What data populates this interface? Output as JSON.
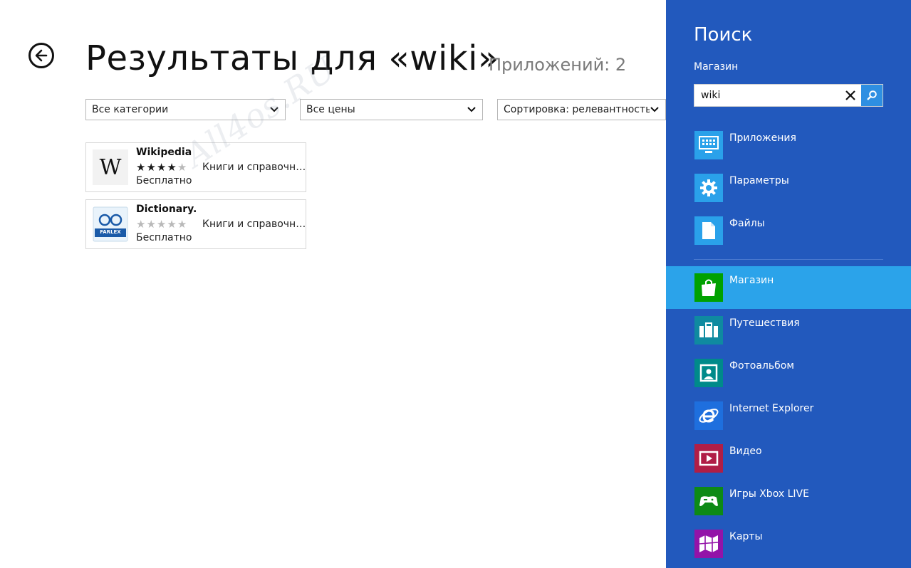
{
  "header": {
    "title": "Результаты для «wiki»",
    "count": "Приложений: 2"
  },
  "filters": [
    {
      "label": "Все категории"
    },
    {
      "label": "Все цены"
    },
    {
      "label": "Сортировка: релевантность"
    }
  ],
  "results": [
    {
      "name": "Wikipedia",
      "rating": 4,
      "max_rating": 5,
      "category": "Книги и справочн…",
      "price": "Бесплатно",
      "icon": "wikipedia-logo-icon",
      "tile_letter": "W"
    },
    {
      "name": "Dictionary.",
      "rating": 0,
      "max_rating": 5,
      "category": "Книги и справочн…",
      "price": "Бесплатно",
      "icon": "farlex-dictionary-icon",
      "tile_text": "FARLEX"
    }
  ],
  "watermark": "All4os.RU",
  "charm": {
    "title": "Поиск",
    "scope": "Магазин",
    "query": "wiki",
    "categories": [
      {
        "label": "Приложения",
        "icon": "apps-icon"
      },
      {
        "label": "Параметры",
        "icon": "settings-gear-icon"
      },
      {
        "label": "Файлы",
        "icon": "file-icon"
      }
    ],
    "apps": [
      {
        "label": "Магазин",
        "icon": "store-bag-icon",
        "color": "#00a100",
        "selected": true
      },
      {
        "label": "Путешествия",
        "icon": "suitcase-icon",
        "color": "#0f8aa0"
      },
      {
        "label": "Фотоальбом",
        "icon": "photo-icon",
        "color": "#008a8a"
      },
      {
        "label": "Internet Explorer",
        "icon": "internet-explorer-icon",
        "color": "#1e6fde"
      },
      {
        "label": "Видео",
        "icon": "video-icon",
        "color": "#b01e46"
      },
      {
        "label": "Игры Xbox LIVE",
        "icon": "xbox-controller-icon",
        "color": "#0d8a16"
      },
      {
        "label": "Карты",
        "icon": "map-icon",
        "color": "#9313a8"
      }
    ]
  },
  "colors": {
    "charm_bg": "#2259bd",
    "selected_bg": "#2ba3ea",
    "category_tile": "#2aa1ea"
  }
}
